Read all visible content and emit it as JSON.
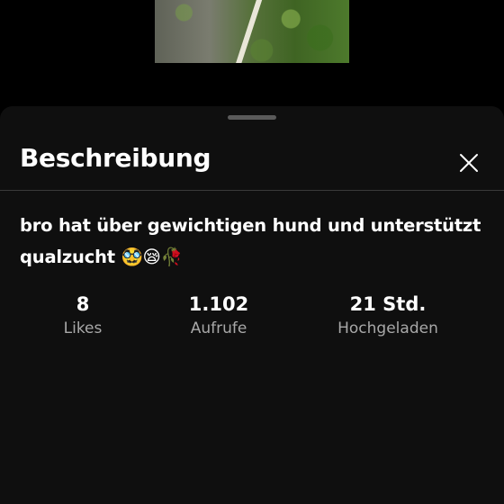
{
  "sheet": {
    "title": "Beschreibung",
    "description": "bro hat über gewichtigen hund und unterstützt qualzucht 🥸😪🥀"
  },
  "stats": {
    "likes": {
      "value": "8",
      "label": "Likes"
    },
    "views": {
      "value": "1.102",
      "label": "Aufrufe"
    },
    "uploaded": {
      "value": "21 Std.",
      "label": "Hochgeladen"
    }
  },
  "icons": {
    "close": "close-icon",
    "handle": "drag-handle"
  },
  "colors": {
    "background": "#000000",
    "sheet": "#0f0f0f",
    "text": "#ffffff",
    "secondary_text": "#a8a8a8",
    "divider": "#3a3a3a"
  }
}
